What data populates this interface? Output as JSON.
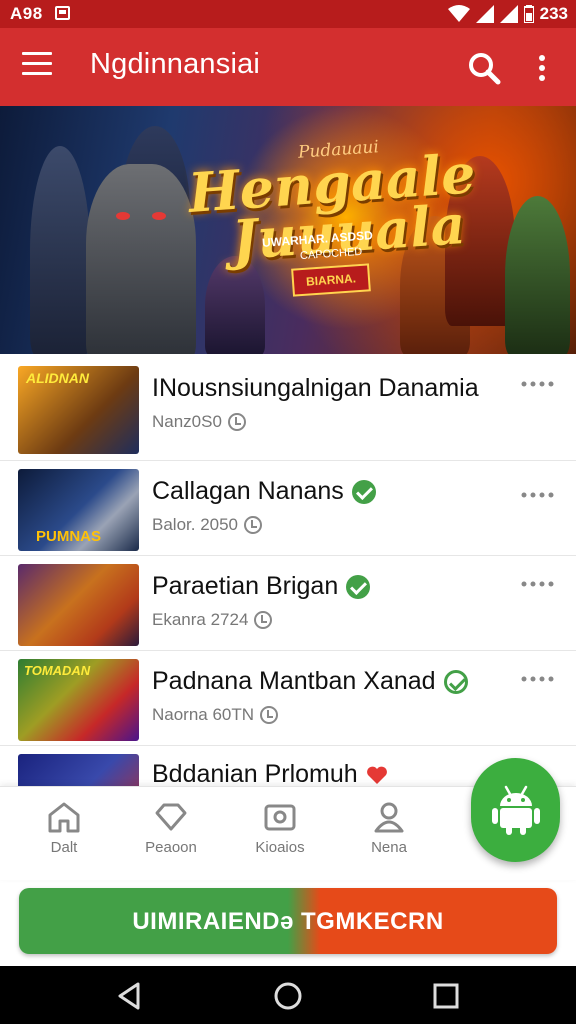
{
  "status_bar": {
    "time": "A98",
    "clock": "233"
  },
  "app_bar": {
    "title": "Ngdinnansiai"
  },
  "banner": {
    "top_text": "Pudauaui",
    "title_line1": "Hengaale",
    "title_line2": "Juuuala",
    "subtitle": "UWARHAR. ASDSD",
    "subtitle2": "CAPOCHED",
    "tag": "BIARNA."
  },
  "list": [
    {
      "title": "INousnsiungalnigan Danamia",
      "meta": "Nanz0S0",
      "badge": "none",
      "thumb_label": "ALIDNAN"
    },
    {
      "title": "Callagan Nanans",
      "meta": "Balor. 2050",
      "badge": "check",
      "thumb_label": "PUMNAS"
    },
    {
      "title": "Paraetian Brigan",
      "meta": "Ekanra 2724",
      "badge": "check",
      "thumb_label": ""
    },
    {
      "title": "Padnana Mantban Xanad",
      "meta": "Naorna 60TN",
      "badge": "check-outline",
      "thumb_label": "TOMADAN"
    },
    {
      "title": "Bddanian Prlomuh",
      "meta": "",
      "badge": "red",
      "thumb_label": ""
    }
  ],
  "bottom_nav": [
    {
      "label": "Dalt",
      "icon": "home-icon"
    },
    {
      "label": "Peaoon",
      "icon": "diamond-icon"
    },
    {
      "label": "Kioaios",
      "icon": "photo-icon"
    },
    {
      "label": "Nena",
      "icon": "person-icon"
    }
  ],
  "fab": {
    "icon": "android-icon"
  },
  "cta": {
    "label": "UIMIRAIENDə TGMKECRN"
  },
  "colors": {
    "primary": "#d32f2f",
    "status_bar": "#b71c1c",
    "accent_green": "#43a047",
    "accent_orange": "#e64a19"
  }
}
